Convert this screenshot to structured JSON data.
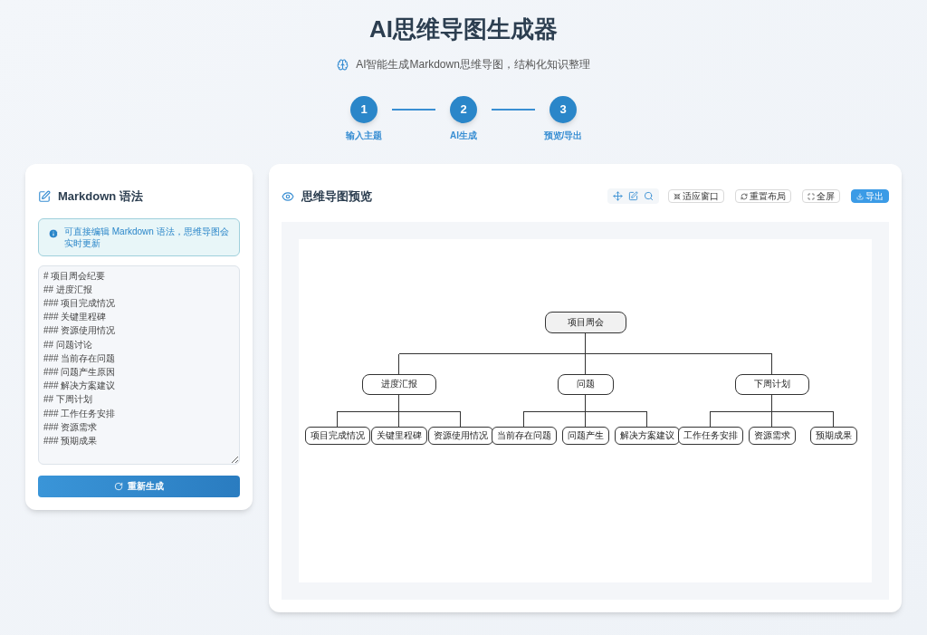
{
  "header": {
    "title": "AI思维导图生成器",
    "subtitle": "AI智能生成Markdown思维导图，结构化知识整理"
  },
  "steps": [
    {
      "number": "1",
      "label": "输入主题"
    },
    {
      "number": "2",
      "label": "AI生成"
    },
    {
      "number": "3",
      "label": "预览/导出"
    }
  ],
  "editor": {
    "title": "Markdown 语法",
    "notice": "可直接编辑 Markdown 语法，思维导图会实时更新",
    "markdown": [
      "# 项目周会纪要",
      "## 进度汇报",
      "### 项目完成情况",
      "### 关键里程碑",
      "### 资源使用情况",
      "## 问题讨论",
      "### 当前存在问题",
      "### 问题产生原因",
      "### 解决方案建议",
      "## 下周计划",
      "### 工作任务安排",
      "### 资源需求",
      "### 预期成果"
    ],
    "button": "重新生成"
  },
  "preview": {
    "title": "思维导图预览",
    "buttons": [
      {
        "label": "适应窗口",
        "kind": "outline"
      },
      {
        "label": "重置布局",
        "kind": "outline"
      },
      {
        "label": "全屏",
        "kind": "outline"
      },
      {
        "label": "导出",
        "kind": "primary"
      }
    ],
    "mindmap": {
      "label": "项目周会",
      "children": [
        {
          "label": "进度汇报",
          "children": [
            {
              "label": "项目完成情况"
            },
            {
              "label": "关键里程碑"
            },
            {
              "label": "资源使用情况"
            }
          ]
        },
        {
          "label": "问题",
          "children": [
            {
              "label": "当前存在问题"
            },
            {
              "label": "问题产生"
            },
            {
              "label": "解决方案建议"
            }
          ]
        },
        {
          "label": "下周计划",
          "children": [
            {
              "label": "工作任务安排"
            },
            {
              "label": "资源需求"
            },
            {
              "label": "预期成果"
            }
          ]
        }
      ]
    }
  }
}
